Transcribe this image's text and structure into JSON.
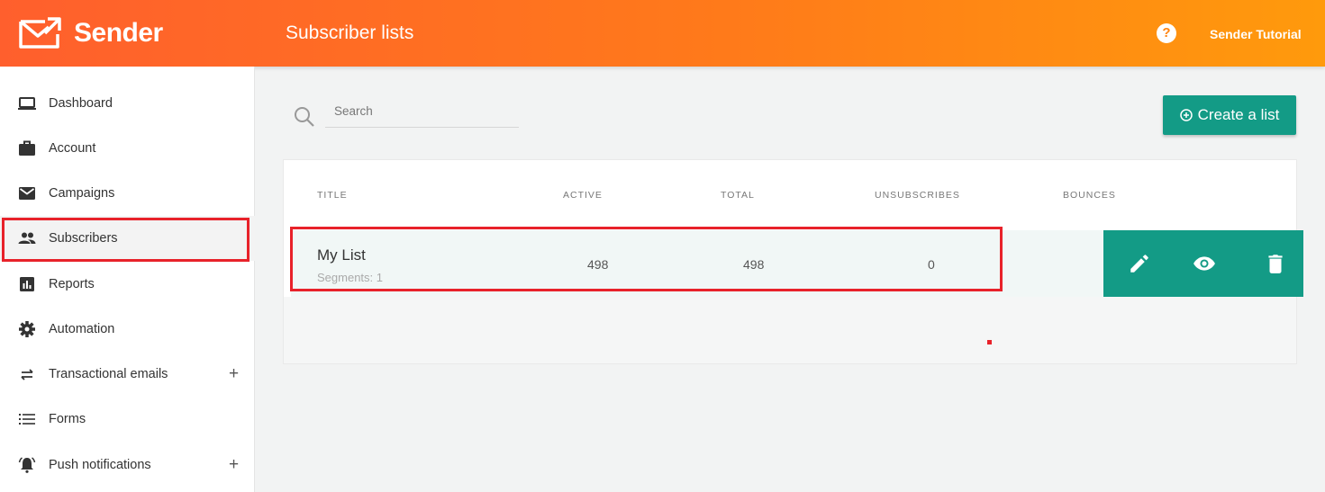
{
  "app": {
    "brand": "Sender",
    "page_title": "Subscriber lists",
    "user_name": "Sender Tutorial",
    "help_icon": "help-circle-icon",
    "brand_color": "#ff6a22",
    "accent": "#139b86"
  },
  "sidebar": {
    "items": [
      {
        "label": "Dashboard",
        "icon": "laptop-icon"
      },
      {
        "label": "Account",
        "icon": "briefcase-icon"
      },
      {
        "label": "Campaigns",
        "icon": "envelope-icon"
      },
      {
        "label": "Subscribers",
        "icon": "people-icon",
        "active": true
      },
      {
        "label": "Reports",
        "icon": "bar-chart-icon"
      },
      {
        "label": "Automation",
        "icon": "gear-icon"
      },
      {
        "label": "Transactional emails",
        "icon": "swap-arrows-icon",
        "expand": "+"
      },
      {
        "label": "Forms",
        "icon": "list-icon"
      },
      {
        "label": "Push notifications",
        "icon": "bell-icon",
        "expand": "+"
      }
    ]
  },
  "search": {
    "placeholder": "Search",
    "value": ""
  },
  "create_button": {
    "label": "Create a list"
  },
  "table": {
    "headers": [
      "TITLE",
      "ACTIVE",
      "TOTAL",
      "UNSUBSCRIBES",
      "BOUNCES"
    ],
    "rows": [
      {
        "title": "My List",
        "segments": "Segments: 1",
        "active": "498",
        "total": "498",
        "unsubscribes": "0",
        "bounces": ""
      }
    ],
    "actions": [
      "edit-icon",
      "view-icon",
      "delete-icon"
    ]
  }
}
